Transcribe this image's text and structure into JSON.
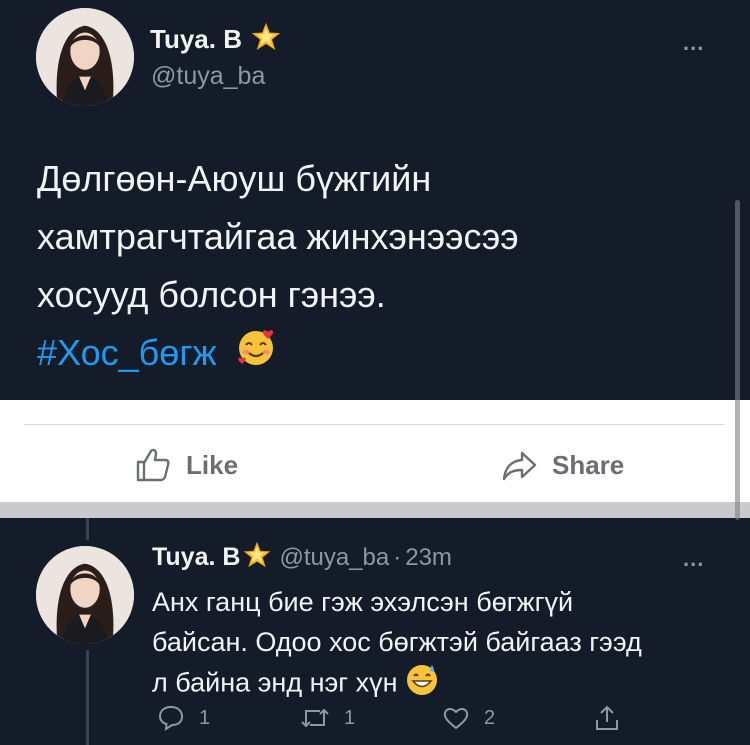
{
  "tweet": {
    "author": "Tuya. B",
    "handle": "@tuya_ba",
    "more": "...",
    "text_line1": "Дөлгөөн-Аюуш бүжгийн",
    "text_line2": "хамтрагчтайгаа жинхэнээсээ",
    "text_line3": "хосууд болсон гэнээ.",
    "hashtag": "#Хос_бөгж"
  },
  "actions": {
    "like_label": "Like",
    "share_label": "Share"
  },
  "reply": {
    "author": "Tuya. B",
    "handle": "@tuya_ba",
    "separator": "·",
    "time": "23m",
    "more": "...",
    "text_line1": "Анх ганц бие гэж эхэлсэн бөгжгүй",
    "text_line2": "байсан. Одоо хос бөгжтэй байгааз гээд",
    "text_line3": "л байна энд нэг хүн",
    "reply_count": "1",
    "retweet_count": "1",
    "like_count": "2"
  },
  "icons": {
    "verified": "star-badge-icon",
    "emoji1": "smiling-face-with-hearts-icon",
    "emoji2": "grinning-sweat-icon"
  },
  "colors": {
    "background_dark": "#151c29",
    "hashtag": "#1d9bf0",
    "secondary_text": "#8b98a5"
  }
}
